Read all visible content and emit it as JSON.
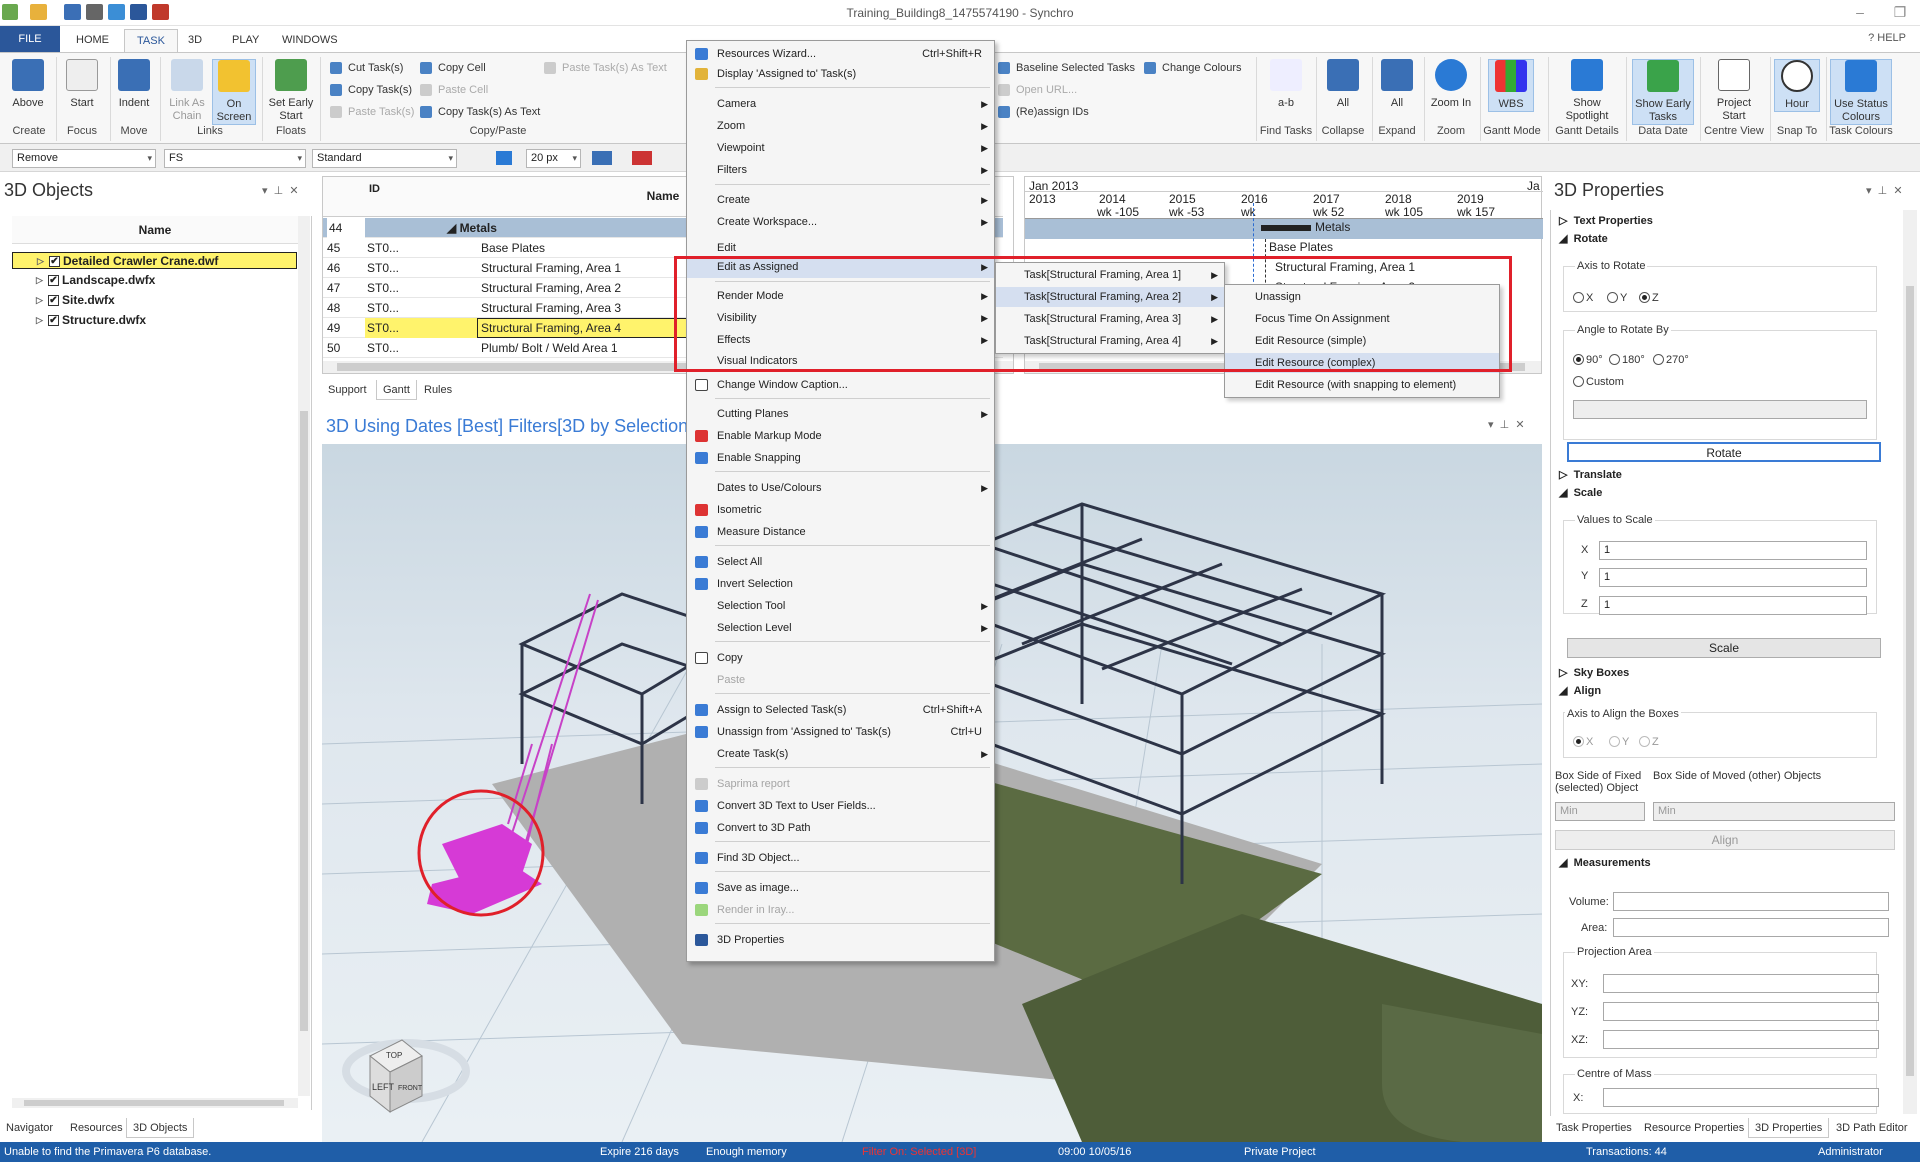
{
  "app": {
    "title": "Training_Building8_1475574190 - Synchro"
  },
  "tabs": [
    "FILE",
    "HOME",
    "TASK",
    "3D",
    "PLAY",
    "WINDOWS"
  ],
  "help_label": "HELP",
  "ribbon": {
    "create": {
      "above": "Above",
      "group": "Create"
    },
    "focus": {
      "start": "Start",
      "group": "Focus"
    },
    "move": {
      "indent": "Indent",
      "group": "Move"
    },
    "links": {
      "link_as_chain": "Link As Chain",
      "on_screen": "On Screen",
      "group": "Links"
    },
    "floats": {
      "set_early_start": "Set Early Start",
      "group": "Floats"
    },
    "copy_paste": {
      "cut": "Cut Task(s)",
      "copy_tasks": "Copy Task(s)",
      "paste_tasks": "Paste Task(s)",
      "copy_cell": "Copy Cell",
      "paste_cell": "Paste Cell",
      "copy_as_text": "Copy Task(s) As Text",
      "paste_as_text": "Paste Task(s) As Text",
      "group": "Copy/Paste"
    },
    "baseline": "Baseline Selected Tasks",
    "change_colours": "Change Colours",
    "open_url": "Open URL...",
    "reassign": "(Re)assign IDs",
    "find_tasks": {
      "label": "a-b",
      "group": "Find Tasks"
    },
    "collapse": {
      "label": "All",
      "group": "Collapse"
    },
    "expand": {
      "label": "All",
      "group": "Expand"
    },
    "zoom": {
      "label": "Zoom In",
      "group": "Zoom"
    },
    "gantt_mode": {
      "label": "WBS",
      "group": "Gantt Mode"
    },
    "gantt_details": {
      "label": "Show Spotlight",
      "group": "Gantt Details"
    },
    "data_date": {
      "label": "Show Early Tasks",
      "group": "Data Date"
    },
    "centre_view": {
      "label": "Project Start",
      "group": "Centre View"
    },
    "snap_to": {
      "label": "Hour",
      "group": "Snap To"
    },
    "task_colours": {
      "label": "Use Status Colours",
      "group": "Task Colours"
    }
  },
  "toolbar2": {
    "combo1": "Remove",
    "combo2": "FS",
    "combo3": "Standard",
    "px": "20 px"
  },
  "objects_panel": {
    "title": "3D Objects",
    "col": "Name",
    "items": [
      "Detailed Crawler Crane.dwf",
      "Landscape.dwfx",
      "Site.dwfx",
      "Structure.dwfx"
    ],
    "bottom_tabs": [
      "Navigator",
      "Resources",
      "3D Objects"
    ]
  },
  "grid": {
    "col_id": "ID",
    "col_name": "Name",
    "rows": [
      {
        "num": "44",
        "id": "",
        "name": "Metals"
      },
      {
        "num": "45",
        "id": "ST0...",
        "name": "Base Plates"
      },
      {
        "num": "46",
        "id": "ST0...",
        "name": "Structural Framing, Area 1"
      },
      {
        "num": "47",
        "id": "ST0...",
        "name": "Structural Framing, Area 2"
      },
      {
        "num": "48",
        "id": "ST0...",
        "name": "Structural Framing, Area 3"
      },
      {
        "num": "49",
        "id": "ST0...",
        "name": "Structural Framing, Area 4"
      },
      {
        "num": "50",
        "id": "ST0...",
        "name": "Plumb/ Bolt / Weld Area 1"
      }
    ],
    "tabs": [
      "Support",
      "Gantt",
      "Rules"
    ]
  },
  "gantt": {
    "month": "Jan 2013",
    "month2": "Ja",
    "years": [
      "2013",
      "2014",
      "2015",
      "2016",
      "2017",
      "2018",
      "2019"
    ],
    "weeks": [
      "wk -105",
      "wk -53",
      "wk",
      "wk 52",
      "wk 105",
      "wk 157"
    ],
    "bars": [
      "Metals",
      "Base Plates",
      "Structural Framing, Area 1",
      "Structural Framing, Area 2"
    ]
  },
  "view3d": {
    "title": "3D Using Dates [Best] Filters[3D by Selection]",
    "cube": {
      "top": "TOP",
      "left": "LEFT",
      "front": "FRONT"
    }
  },
  "context_menu": [
    {
      "label": "Resources Wizard...",
      "shortcut": "Ctrl+Shift+R"
    },
    {
      "label": "Display 'Assigned to' Task(s)"
    },
    {
      "label": "Camera",
      "sub": true
    },
    {
      "label": "Zoom",
      "sub": true
    },
    {
      "label": "Viewpoint",
      "sub": true
    },
    {
      "label": "Filters",
      "sub": true
    },
    {
      "label": "Create",
      "sub": true
    },
    {
      "label": "Create Workspace...",
      "sub": true
    },
    {
      "label": "Edit",
      "sub": true
    },
    {
      "label": "Edit as Assigned",
      "sub": true
    },
    {
      "label": "Render Mode",
      "sub": true
    },
    {
      "label": "Visibility",
      "sub": true
    },
    {
      "label": "Effects",
      "sub": true
    },
    {
      "label": "Visual Indicators",
      "sub": true
    },
    {
      "label": "Change Window Caption..."
    },
    {
      "label": "Cutting Planes",
      "sub": true
    },
    {
      "label": "Enable Markup Mode"
    },
    {
      "label": "Enable Snapping"
    },
    {
      "label": "Dates to Use/Colours",
      "sub": true
    },
    {
      "label": "Isometric"
    },
    {
      "label": "Measure Distance"
    },
    {
      "label": "Select All"
    },
    {
      "label": "Invert Selection"
    },
    {
      "label": "Selection Tool",
      "sub": true
    },
    {
      "label": "Selection Level",
      "sub": true
    },
    {
      "label": "Copy"
    },
    {
      "label": "Paste"
    },
    {
      "label": "Assign to Selected Task(s)",
      "shortcut": "Ctrl+Shift+A"
    },
    {
      "label": "Unassign from 'Assigned to' Task(s)",
      "shortcut": "Ctrl+U"
    },
    {
      "label": "Create Task(s)",
      "sub": true
    },
    {
      "label": "Saprima report"
    },
    {
      "label": "Convert 3D Text to User Fields..."
    },
    {
      "label": "Convert to 3D Path"
    },
    {
      "label": "Find 3D Object..."
    },
    {
      "label": "Save as image..."
    },
    {
      "label": "Render in Iray..."
    },
    {
      "label": "3D Properties"
    }
  ],
  "submenu_tasks": [
    "Task[Structural Framing, Area 1]",
    "Task[Structural Framing, Area 2]",
    "Task[Structural Framing, Area 3]",
    "Task[Structural Framing, Area 4]"
  ],
  "submenu_actions": [
    "Unassign",
    "Focus Time On Assignment",
    "Edit Resource (simple)",
    "Edit Resource (complex)",
    "Edit Resource (with snapping to element)"
  ],
  "props": {
    "title": "3D Properties",
    "text_properties": "Text Properties",
    "rotate": "Rotate",
    "axis_to_rotate": "Axis to Rotate",
    "axes": [
      "X",
      "Y",
      "Z"
    ],
    "angle_to_rotate": "Angle to Rotate By",
    "angles": [
      "90°",
      "180°",
      "270°"
    ],
    "custom": "Custom",
    "rotate_btn": "Rotate",
    "translate": "Translate",
    "scale": "Scale",
    "values_to_scale": "Values to Scale",
    "scale_x": "1",
    "scale_y": "1",
    "scale_z": "1",
    "scale_btn": "Scale",
    "sky_boxes": "Sky Boxes",
    "align": "Align",
    "axis_align": "Axis to Align the Boxes",
    "box_fixed": "Box Side of Fixed (selected) Object",
    "box_moved": "Box Side of Moved (other) Objects",
    "min1": "Min",
    "min2": "Min",
    "align_btn": "Align",
    "measurements": "Measurements",
    "volume": "Volume:",
    "area": "Area:",
    "projection_area": "Projection Area",
    "xy": "XY:",
    "yz": "YZ:",
    "xz": "XZ:",
    "centre_of_mass": "Centre of Mass",
    "x": "X:",
    "bottom_tabs": [
      "Task Properties",
      "Resource Properties",
      "3D Properties",
      "3D Path Editor"
    ]
  },
  "status": {
    "msg": "Unable to find the Primavera P6 database.",
    "expire": "Expire 216 days",
    "memory": "Enough memory",
    "filter": "Filter On: Selected [3D]",
    "datetime": "09:00 10/05/16",
    "project": "Private Project",
    "transactions": "Transactions: 44",
    "user": "Administrator"
  },
  "colors": {
    "accent": "#2b579a",
    "highlight_red": "#e0202a",
    "magenta": "#d63ad6",
    "status_bar": "#1f5ea8"
  }
}
